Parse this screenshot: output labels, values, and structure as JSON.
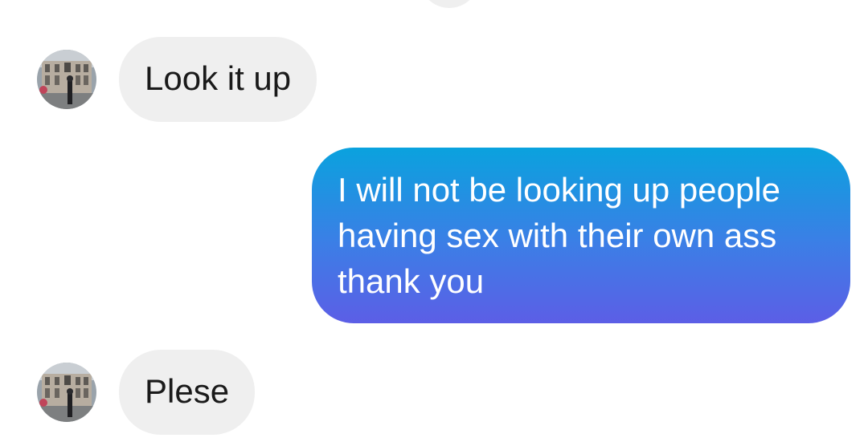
{
  "messages": [
    {
      "sender": "other",
      "text": "Look it up",
      "avatar_icon": "building-photo-avatar"
    },
    {
      "sender": "me",
      "lines": [
        "I will not be looking up people",
        "having sex with their own ass",
        "thank you"
      ]
    },
    {
      "sender": "other",
      "text": "Plese",
      "avatar_icon": "building-photo-avatar"
    }
  ],
  "colors": {
    "incoming_bubble": "#efefef",
    "incoming_text": "#1a1a1a",
    "outgoing_gradient_top": "#0aa2de",
    "outgoing_gradient_bottom": "#5c5ee6",
    "outgoing_text": "#ffffff",
    "background": "#ffffff"
  }
}
